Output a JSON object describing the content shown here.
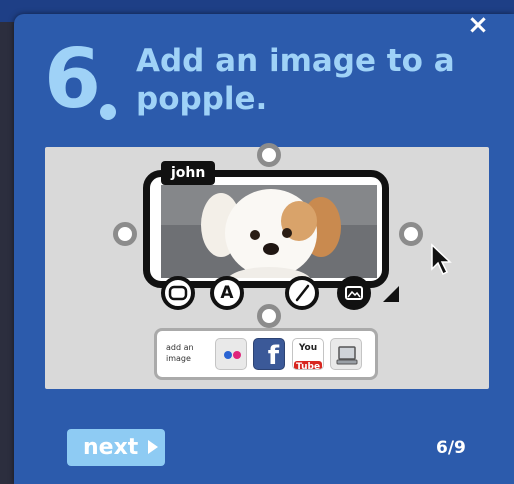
{
  "dialog": {
    "close_symbol": "×",
    "step_number": "6",
    "title": "Add an image to a popple.",
    "next_label": "next",
    "page_counter": "6/9"
  },
  "popple": {
    "name_tag": "john",
    "image_subject": "puppy-photo",
    "tools": [
      {
        "name": "shape-tool-icon",
        "glyph": ""
      },
      {
        "name": "text-tool-icon",
        "glyph": "A"
      },
      {
        "name": "pen-tool-icon",
        "glyph": ""
      },
      {
        "name": "image-tool-icon",
        "glyph": ""
      }
    ]
  },
  "image_sources": {
    "label": "add an image",
    "buttons": [
      {
        "name": "flickr-button",
        "icon": "flickr-icon"
      },
      {
        "name": "facebook-button",
        "icon": "facebook-icon",
        "text": "f"
      },
      {
        "name": "youtube-button",
        "icon": "youtube-icon",
        "text_top": "You",
        "text_bottom": "Tube"
      },
      {
        "name": "computer-button",
        "icon": "computer-icon"
      }
    ]
  },
  "colors": {
    "panel": "#2c5bac",
    "accent_light_blue": "#9fd2f7",
    "next_button": "#8ecbf3",
    "stage": "#d9d9d9"
  }
}
